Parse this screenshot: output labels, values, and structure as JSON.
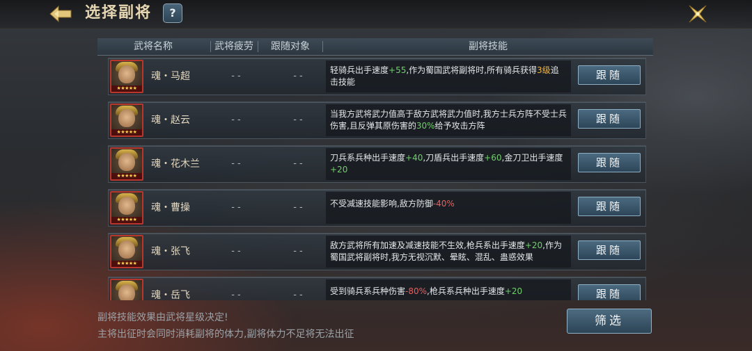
{
  "header": {
    "title": "选择副将",
    "help_label": "?"
  },
  "icons": {
    "back": "back-arrow-icon",
    "close": "close-x-icon",
    "help": "question-icon"
  },
  "columns": {
    "name": "武将名称",
    "fatigue": "武将疲劳",
    "follow": "跟随对象",
    "skill": "副将技能"
  },
  "rows": [
    {
      "name": "魂・马超",
      "fatigue": "- -",
      "follow": "- -",
      "stars": "★★★★★",
      "button": "跟随",
      "skill": [
        {
          "t": "轻骑兵出手速度"
        },
        {
          "t": "+55",
          "c": "green"
        },
        {
          "t": ",作为蜀国武将副将时,所有骑兵获得"
        },
        {
          "t": "3级",
          "c": "orange"
        },
        {
          "t": "追击技能"
        }
      ]
    },
    {
      "name": "魂・赵云",
      "fatigue": "- -",
      "follow": "- -",
      "stars": "★★★★★",
      "button": "跟随",
      "skill": [
        {
          "t": "当我方武将武力值高于敌方武将武力值时,我方士兵方阵不受士兵伤害,且反弹其原伤害的"
        },
        {
          "t": "30%",
          "c": "green"
        },
        {
          "t": "给予攻击方阵"
        }
      ]
    },
    {
      "name": "魂・花木兰",
      "fatigue": "- -",
      "follow": "- -",
      "stars": "★★★★★",
      "button": "跟随",
      "skill": [
        {
          "t": "刀兵系兵种出手速度"
        },
        {
          "t": "+40",
          "c": "green"
        },
        {
          "t": ",刀盾兵出手速度"
        },
        {
          "t": "+60",
          "c": "green"
        },
        {
          "t": ",金刀卫出手速度"
        },
        {
          "t": "+20",
          "c": "green"
        }
      ]
    },
    {
      "name": "魂・曹操",
      "fatigue": "- -",
      "follow": "- -",
      "stars": "★★★★★",
      "button": "跟随",
      "single": true,
      "skill": [
        {
          "t": "不受减速技能影响,敌方防御"
        },
        {
          "t": "-40%",
          "c": "red"
        }
      ]
    },
    {
      "name": "魂・张飞",
      "fatigue": "- -",
      "follow": "- -",
      "stars": "★★★★★",
      "button": "跟随",
      "skill": [
        {
          "t": "敌方武将所有加速及减速技能不生效,枪兵系出手速度"
        },
        {
          "t": "+20",
          "c": "green"
        },
        {
          "t": ",作为蜀国武将副将时,我方无视沉默、晕眩、混乱、蛊惑效果"
        }
      ]
    },
    {
      "name": "魂・岳飞",
      "fatigue": "- -",
      "follow": "- -",
      "stars": "★★★★★",
      "button": "跟随",
      "single": true,
      "skill": [
        {
          "t": "受到骑兵系兵种伤害"
        },
        {
          "t": "-80%",
          "c": "red"
        },
        {
          "t": ",枪兵系兵种出手速度"
        },
        {
          "t": "+20",
          "c": "green"
        }
      ]
    }
  ],
  "footer": {
    "note1": "副将技能效果由武将星级决定!",
    "note2": "主将出征时会同时消耗副将的体力,副将体力不足将无法出征",
    "filter_label": "筛选"
  },
  "colors": {
    "accent_green": "#6fd06a",
    "accent_red": "#e46060",
    "accent_orange": "#f0b54a",
    "title_gold": "#e6d7b2"
  }
}
